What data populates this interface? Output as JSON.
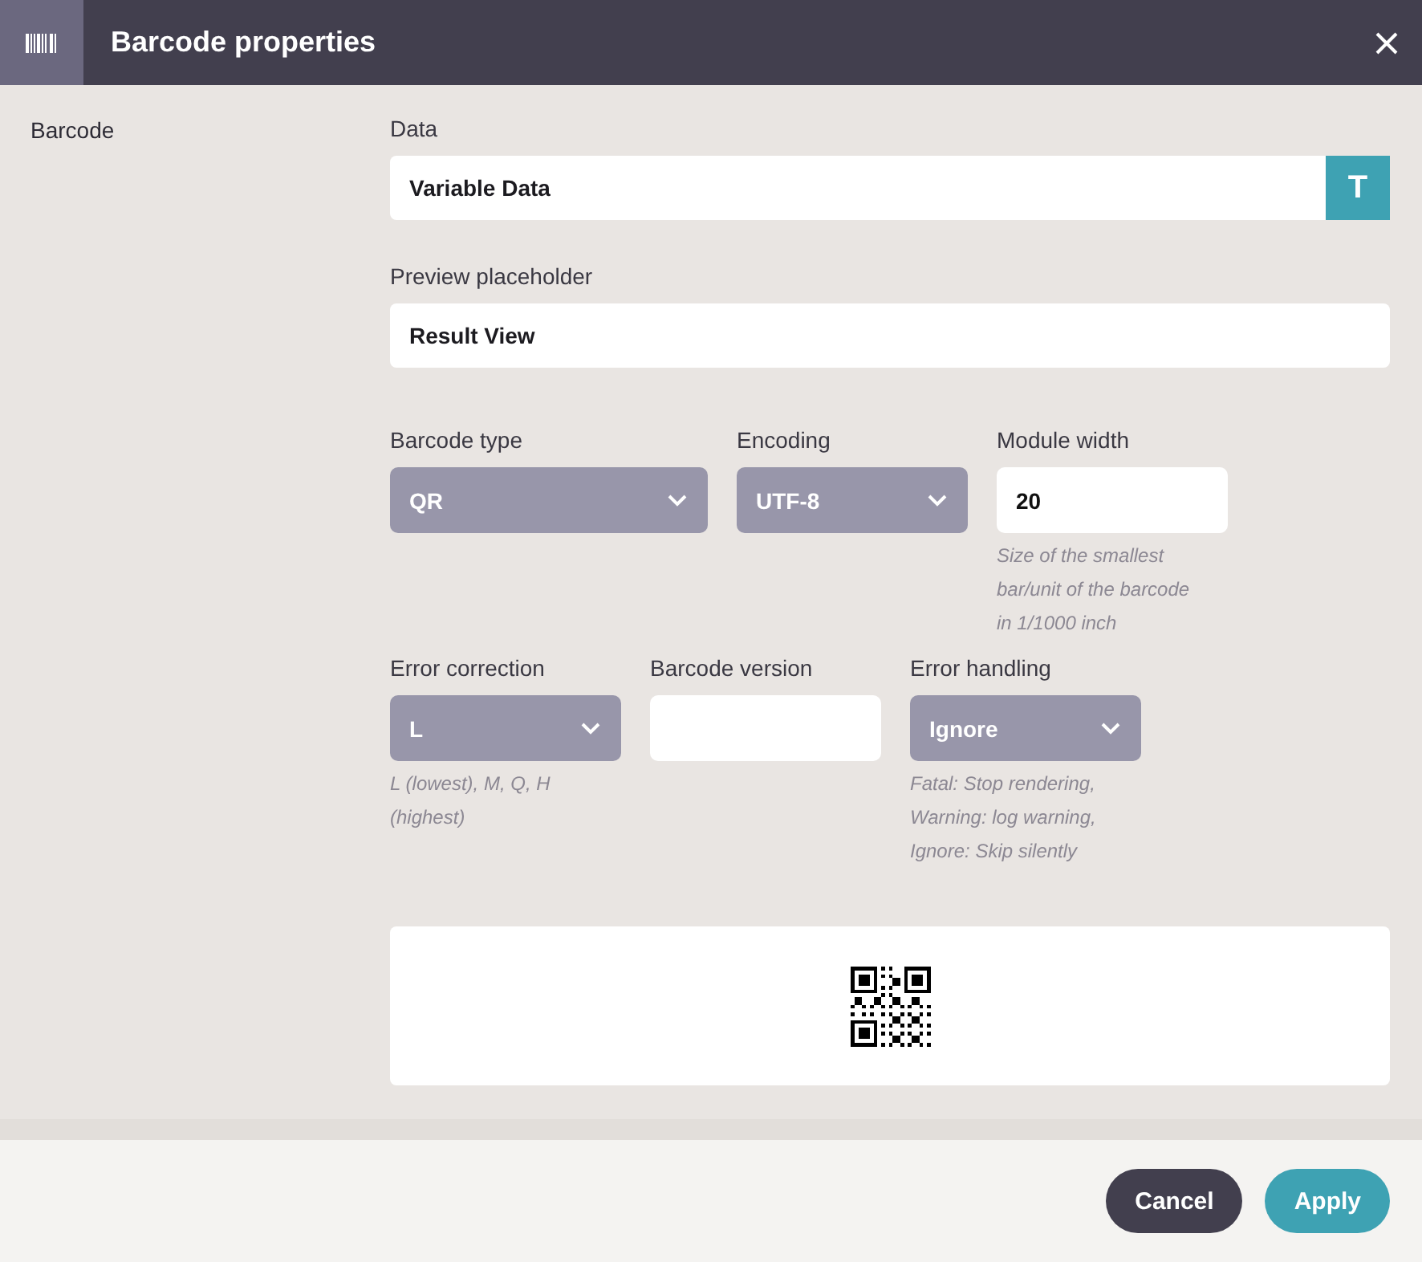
{
  "window": {
    "title": "Barcode properties"
  },
  "sidebar": {
    "items": [
      {
        "label": "Barcode"
      }
    ]
  },
  "data_field": {
    "label": "Data",
    "value": "Variable Data",
    "button": "T"
  },
  "preview_field": {
    "label": "Preview placeholder",
    "value": "Result View"
  },
  "rows": [
    [
      {
        "kind": "select",
        "label": "Barcode type",
        "value": "QR"
      },
      {
        "kind": "select",
        "label": "Encoding",
        "value": "UTF-8"
      },
      {
        "kind": "input",
        "label": "Module width",
        "value": "20",
        "hint": [
          "Size of the smallest",
          "bar/unit of the barcode",
          "in 1/1000 inch"
        ]
      }
    ],
    [
      {
        "kind": "select",
        "label": "Error correction",
        "value": "L",
        "hint": [
          "L (lowest), M, Q, H",
          "(highest)"
        ]
      },
      {
        "kind": "input",
        "label": "Barcode version"
      },
      {
        "kind": "select",
        "label": "Error handling",
        "value": "Ignore",
        "hint": [
          "Fatal: Stop rendering,",
          "Warning: log warning,",
          "Ignore: Skip silently"
        ]
      }
    ]
  ],
  "footer": {
    "buttons": [
      {
        "label": "Cancel",
        "kind": "secondary"
      },
      {
        "label": "Apply",
        "kind": "primary"
      }
    ]
  }
}
